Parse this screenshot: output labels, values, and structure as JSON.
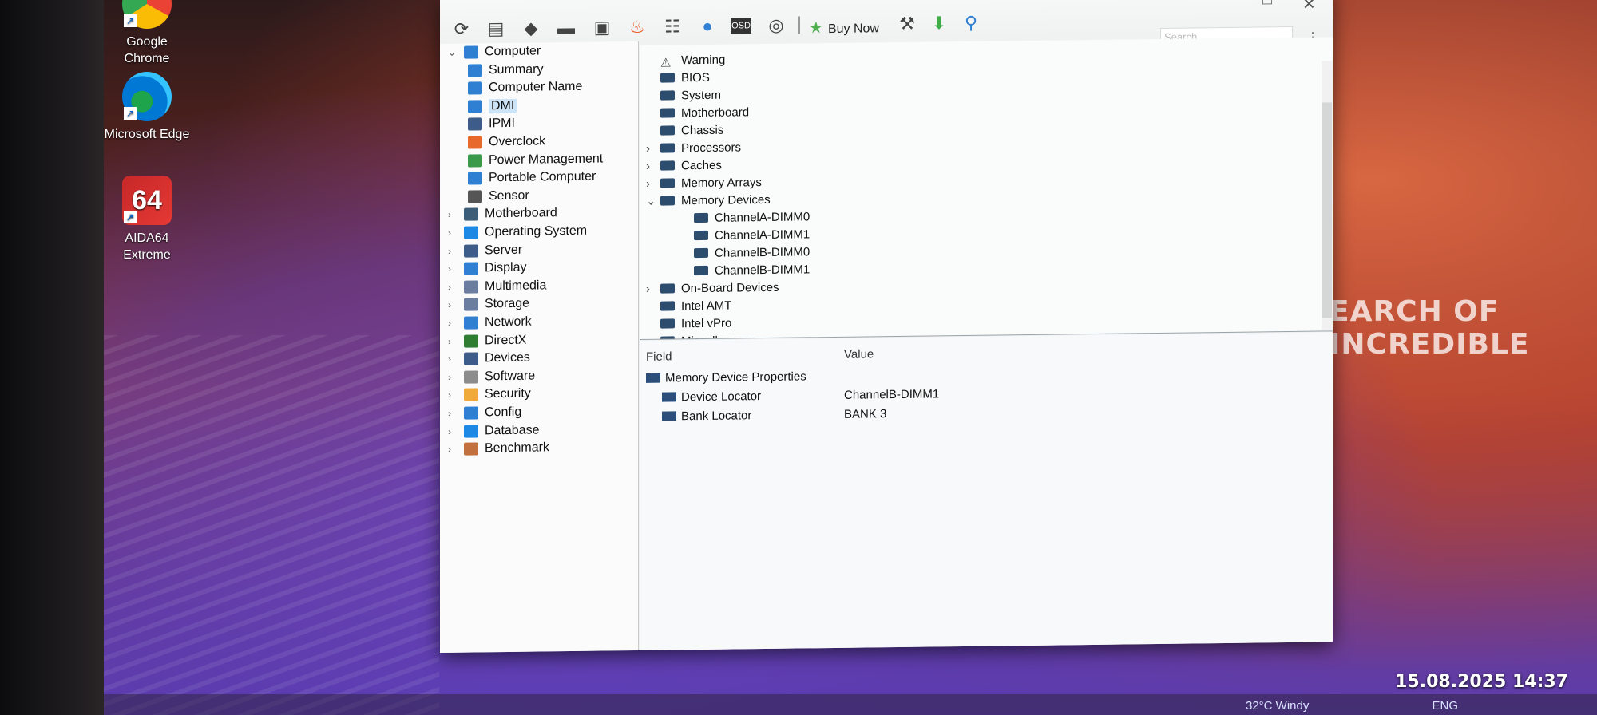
{
  "desktop": {
    "icons": [
      {
        "label": "Google Chrome"
      },
      {
        "label": "Microsoft Edge"
      },
      {
        "label": "AIDA64 Extreme",
        "badge": "64"
      }
    ],
    "wallpaper_text": "EARCH OF INCREDIBLE"
  },
  "toolbar": {
    "buy_now": "Buy Now",
    "search_placeholder": "Search",
    "osd_label": "OSD"
  },
  "tree": {
    "items": [
      {
        "label": "Computer",
        "level": 0,
        "expanded": true,
        "icon": "computer-icon",
        "color": "#2f7fd3"
      },
      {
        "label": "Summary",
        "level": 1,
        "icon": "summary-icon",
        "color": "#2f7fd3"
      },
      {
        "label": "Computer Name",
        "level": 1,
        "icon": "computer-name-icon",
        "color": "#2f7fd3"
      },
      {
        "label": "DMI",
        "level": 1,
        "selected": true,
        "icon": "dmi-icon",
        "color": "#2f7fd3"
      },
      {
        "label": "IPMI",
        "level": 1,
        "icon": "ipmi-icon",
        "color": "#3e5c8a"
      },
      {
        "label": "Overclock",
        "level": 1,
        "icon": "flame-icon",
        "color": "#e8692c"
      },
      {
        "label": "Power Management",
        "level": 1,
        "icon": "battery-icon",
        "color": "#3a9a4a"
      },
      {
        "label": "Portable Computer",
        "level": 1,
        "icon": "laptop-icon",
        "color": "#2f7fd3"
      },
      {
        "label": "Sensor",
        "level": 1,
        "icon": "sensor-icon",
        "color": "#555555"
      },
      {
        "label": "Motherboard",
        "level": 0,
        "icon": "motherboard-icon",
        "color": "#3b5d78"
      },
      {
        "label": "Operating System",
        "level": 0,
        "icon": "windows-icon",
        "color": "#1e88e5"
      },
      {
        "label": "Server",
        "level": 0,
        "icon": "server-icon",
        "color": "#3e5c8a"
      },
      {
        "label": "Display",
        "level": 0,
        "icon": "display-icon",
        "color": "#2f7fd3"
      },
      {
        "label": "Multimedia",
        "level": 0,
        "icon": "multimedia-icon",
        "color": "#6b7ea0"
      },
      {
        "label": "Storage",
        "level": 0,
        "icon": "storage-icon",
        "color": "#6b7ea0"
      },
      {
        "label": "Network",
        "level": 0,
        "icon": "network-icon",
        "color": "#2f7fd3"
      },
      {
        "label": "DirectX",
        "level": 0,
        "icon": "xbox-icon",
        "color": "#2e7d32"
      },
      {
        "label": "Devices",
        "level": 0,
        "icon": "devices-icon",
        "color": "#3e5c8a"
      },
      {
        "label": "Software",
        "level": 0,
        "icon": "software-icon",
        "color": "#8c8c8c"
      },
      {
        "label": "Security",
        "level": 0,
        "icon": "shield-icon",
        "color": "#f2a93b"
      },
      {
        "label": "Config",
        "level": 0,
        "icon": "config-icon",
        "color": "#2f7fd3"
      },
      {
        "label": "Database",
        "level": 0,
        "icon": "database-icon",
        "color": "#1e88e5"
      },
      {
        "label": "Benchmark",
        "level": 0,
        "icon": "benchmark-icon",
        "color": "#c2703d"
      }
    ]
  },
  "list": {
    "items": [
      {
        "label": "Warning",
        "level": 0,
        "caret": "",
        "icon": "warning-icon"
      },
      {
        "label": "BIOS",
        "level": 0,
        "caret": "",
        "icon": "bios-icon"
      },
      {
        "label": "System",
        "level": 0,
        "caret": "",
        "icon": "system-icon"
      },
      {
        "label": "Motherboard",
        "level": 0,
        "caret": "",
        "icon": "motherboard-icon"
      },
      {
        "label": "Chassis",
        "level": 0,
        "caret": "",
        "icon": "chassis-icon"
      },
      {
        "label": "Processors",
        "level": 0,
        "caret": "›",
        "icon": "processor-icon"
      },
      {
        "label": "Caches",
        "level": 0,
        "caret": "›",
        "icon": "cache-icon"
      },
      {
        "label": "Memory Arrays",
        "level": 0,
        "caret": "›",
        "icon": "memory-icon"
      },
      {
        "label": "Memory Devices",
        "level": 0,
        "caret": "⌄",
        "icon": "memory-icon"
      },
      {
        "label": "ChannelA-DIMM0",
        "level": 1,
        "caret": "",
        "icon": "memory-icon"
      },
      {
        "label": "ChannelA-DIMM1",
        "level": 1,
        "caret": "",
        "icon": "memory-icon"
      },
      {
        "label": "ChannelB-DIMM0",
        "level": 1,
        "caret": "",
        "icon": "memory-icon"
      },
      {
        "label": "ChannelB-DIMM1",
        "level": 1,
        "caret": "",
        "icon": "memory-icon"
      },
      {
        "label": "On-Board Devices",
        "level": 0,
        "caret": "›",
        "icon": "device-icon"
      },
      {
        "label": "Intel AMT",
        "level": 0,
        "caret": "",
        "icon": "intel-icon"
      },
      {
        "label": "Intel vPro",
        "level": 0,
        "caret": "",
        "icon": "intel-icon"
      },
      {
        "label": "Miscellaneous",
        "level": 0,
        "caret": "",
        "icon": "misc-icon"
      }
    ]
  },
  "properties": {
    "field_header": "Field",
    "value_header": "Value",
    "group": "Memory Device Properties",
    "rows": [
      {
        "field": "Device Locator",
        "value": "ChannelB-DIMM1"
      },
      {
        "field": "Bank Locator",
        "value": "BANK 3"
      }
    ]
  },
  "taskbar": {
    "weather": "32°C  Windy",
    "lang": "ENG"
  },
  "photo_stamp": "15.08.2025  14:37"
}
